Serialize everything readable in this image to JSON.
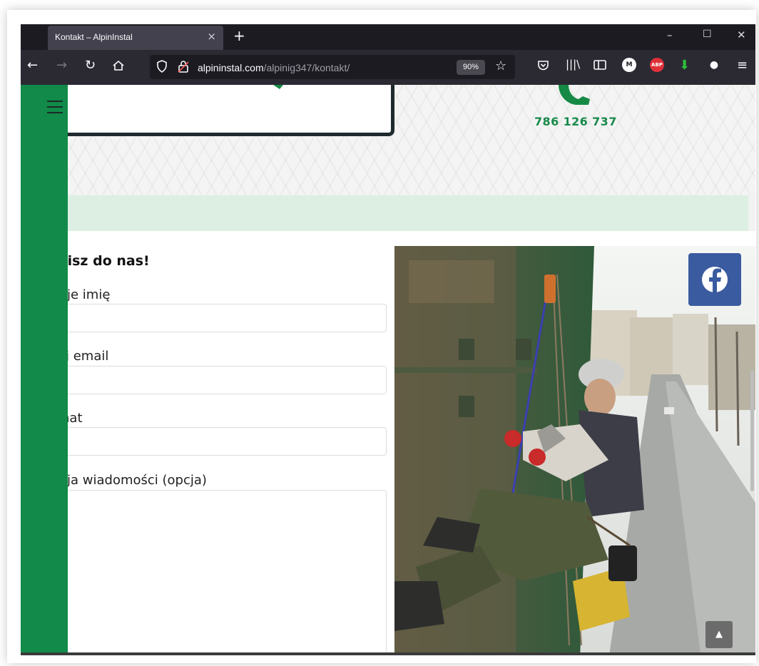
{
  "browser": {
    "tab_title": "Kontakt – AlpinInstal",
    "tab_close": "×",
    "new_tab": "+",
    "minimize": "–",
    "maximize": "☐",
    "close": "✕",
    "url_host": "alpininstal.com",
    "url_path": "/alpinig347/kontakt/",
    "zoom": "90%"
  },
  "header": {
    "phone_number": "786 126 737"
  },
  "form": {
    "heading": "bisz do nas!",
    "name_label": "oje imię",
    "email_label": "ój email",
    "subject_label": "nat",
    "message_label": "oja wiadomości (opcja)"
  },
  "colors": {
    "sidebar": "#118a4a",
    "accent_green": "#1a8a4c",
    "facebook": "#3b5ba0",
    "band": "#dcefe2"
  },
  "icons": [
    "back-icon",
    "forward-icon",
    "reload-icon",
    "home-icon",
    "shield-icon",
    "lock-icon",
    "star-icon",
    "pocket-icon",
    "library-icon",
    "sidebar-icon",
    "extension-m-icon",
    "adblock-icon",
    "download-icon",
    "extension-icon",
    "menu-icon",
    "phone-icon",
    "facebook-icon",
    "arrow-up-icon",
    "hamburger-icon"
  ]
}
